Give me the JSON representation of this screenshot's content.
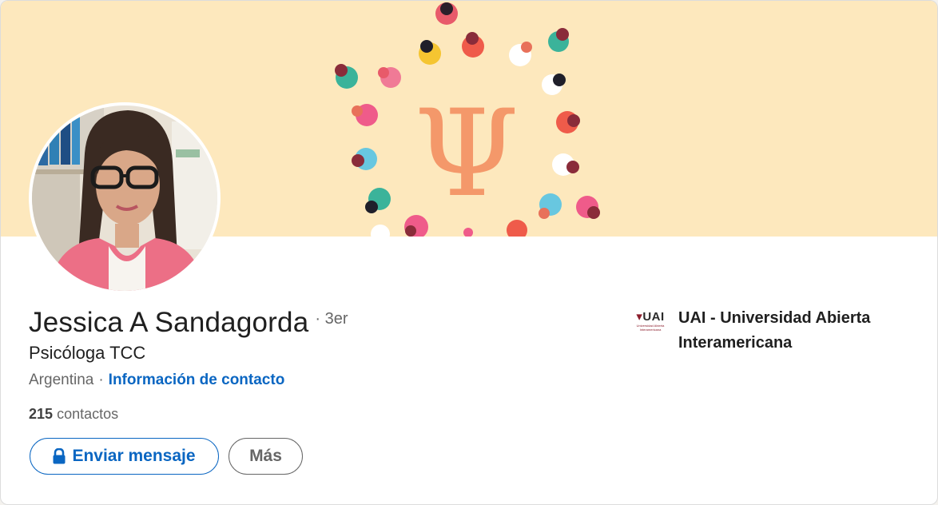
{
  "profile": {
    "name": "Jessica A Sandagorda",
    "degree": "· 3er",
    "headline": "Psicóloga TCC",
    "location": "Argentina",
    "separator": "·",
    "contact_info": "Información de contacto",
    "connections_count": "215",
    "connections_label": "contactos"
  },
  "actions": {
    "message_label": "Enviar mensaje",
    "more_label": "Más"
  },
  "education": {
    "logo_text": "UAI",
    "logo_caption": "Universidad Abierta Interamericana",
    "name": "UAI - Universidad Abierta Interamericana"
  },
  "banner": {
    "symbol": "Ψ"
  },
  "icons": {
    "message": "lock-icon",
    "banner": "people-circle-psi-illustration"
  },
  "colors": {
    "accent": "#0a66c2",
    "banner_bg": "#fde8bd",
    "psi": "#f4986a",
    "uai": "#8b1d2c"
  }
}
